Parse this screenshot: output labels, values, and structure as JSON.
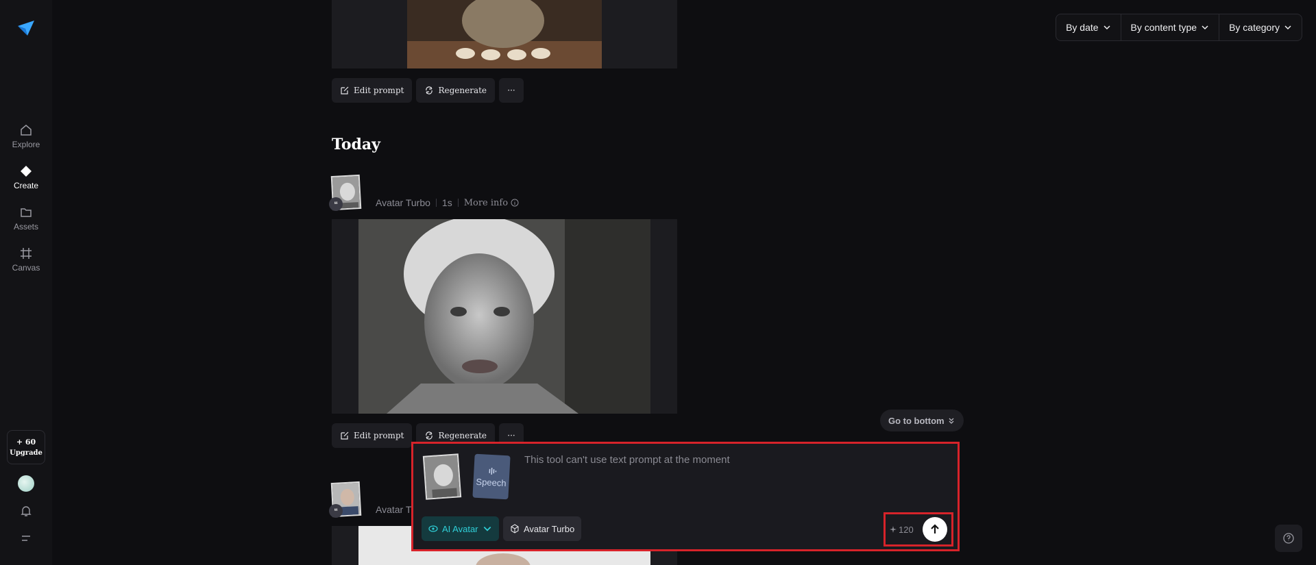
{
  "sidebar": {
    "items": [
      {
        "label": "Explore",
        "icon": "home-icon"
      },
      {
        "label": "Create",
        "icon": "diamond-icon"
      },
      {
        "label": "Assets",
        "icon": "folder-icon"
      },
      {
        "label": "Canvas",
        "icon": "canvas-icon"
      }
    ],
    "credits": "+ 60",
    "upgrade_label": "Upgrade"
  },
  "filters": {
    "by_date": "By date",
    "by_content_type": "By content type",
    "by_category": "By category"
  },
  "feed": {
    "actions": {
      "edit_prompt": "Edit prompt",
      "regenerate": "Regenerate",
      "more": "···"
    },
    "section_title": "Today",
    "entry": {
      "model": "Avatar Turbo",
      "time": "1s",
      "more_info": "More info"
    },
    "entry2_model_partial": "Avatar T"
  },
  "go_bottom": "Go to bottom",
  "composer": {
    "placeholder": "This tool can't use text prompt at the moment",
    "speech_label": "Speech",
    "tool_label": "AI Avatar",
    "model_label": "Avatar Turbo",
    "cost": "120"
  },
  "colors": {
    "accent_teal": "#2fd0d8",
    "highlight_red": "#d7232a",
    "background": "#0e0e11"
  }
}
